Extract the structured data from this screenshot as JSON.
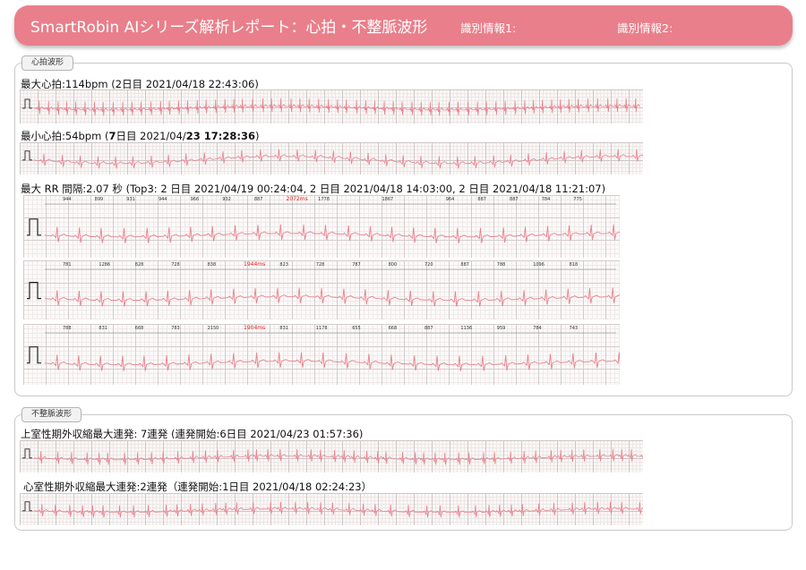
{
  "header": {
    "title": "SmartRobin AIシリーズ解析レポート：心拍・不整脈波形",
    "id1_label": "識別情報1:",
    "id2_label": "識別情報2:"
  },
  "heart_section": {
    "tab": "心拍波形",
    "max_hr": "最大心拍:114bpm (2日目 2021/04/18 22:43:06)",
    "min_hr_prefix": "最小心拍:54bpm (",
    "min_hr_bold1": "7",
    "min_hr_mid": "日目 2021/04/",
    "min_hr_bold2": "23 17:28:36",
    "min_hr_suffix": ")",
    "max_rr": "最大 RR 間隔:2.07 秒 (Top3: 2 日目 2021/04/19 00:24:04, 2 日目 2021/04/18 14:03:00, 2 日目 2021/04/18 11:21:07)",
    "rr_strips": [
      {
        "values": [
          "944",
          "899",
          "931",
          "944",
          "966",
          "932",
          "887",
          "2072ms",
          "1778",
          "",
          "1867",
          "",
          "964",
          "887",
          "887",
          "784",
          "775"
        ],
        "max_index": 7
      },
      {
        "values": [
          "781",
          "1286",
          "828",
          "728",
          "838",
          "1944ms",
          "823",
          "728",
          "787",
          "800",
          "720",
          "887",
          "788",
          "1096",
          "818"
        ],
        "max_index": 5
      },
      {
        "values": [
          "788",
          "831",
          "668",
          "783",
          "2150",
          "1904ms",
          "831",
          "1178",
          "655",
          "668",
          "887",
          "1136",
          "959",
          "784",
          "743"
        ],
        "max_index": 5
      }
    ]
  },
  "arrhythmia_section": {
    "tab": "不整脈波形",
    "svpc": "上室性期外収縮最大連発: 7連発 (連発開始:6日目 2021/04/23 01:57:36)",
    "vpc": "心室性期外収縮最大連発:2連発（連発開始:1日目 2021/04/18 02:24:23）"
  },
  "colors": {
    "header": "#e97f8b",
    "ecg_trace": "#e8828e",
    "rr_max": "#e02020"
  }
}
